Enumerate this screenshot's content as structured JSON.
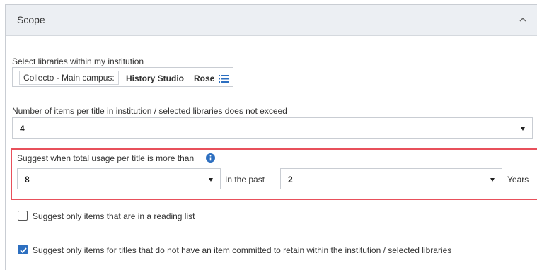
{
  "section": {
    "title": "Scope"
  },
  "libraries": {
    "label": "Select libraries within my institution",
    "prefix": "Collecto - Main campus:",
    "items": [
      "History Studio",
      "Rose"
    ]
  },
  "items_per_title": {
    "label": "Number of items per title in institution / selected libraries does not exceed",
    "value": "4"
  },
  "usage": {
    "label": "Suggest when total usage per title is more than",
    "value": "8",
    "in_the_past_label": "In the past",
    "period_value": "2",
    "unit_label": "Years"
  },
  "reading_list": {
    "label": "Suggest only items that are in a reading list",
    "checked": false
  },
  "retain": {
    "label": "Suggest only items for titles that do not have an item committed to retain within the institution / selected libraries",
    "checked": true
  },
  "colors": {
    "accent": "#2d6fc0",
    "highlight": "#e8505b",
    "header_bg": "#eceff3"
  },
  "icons": {
    "collapse": "chevron-up-icon",
    "list": "list-icon",
    "info": "info-icon"
  }
}
